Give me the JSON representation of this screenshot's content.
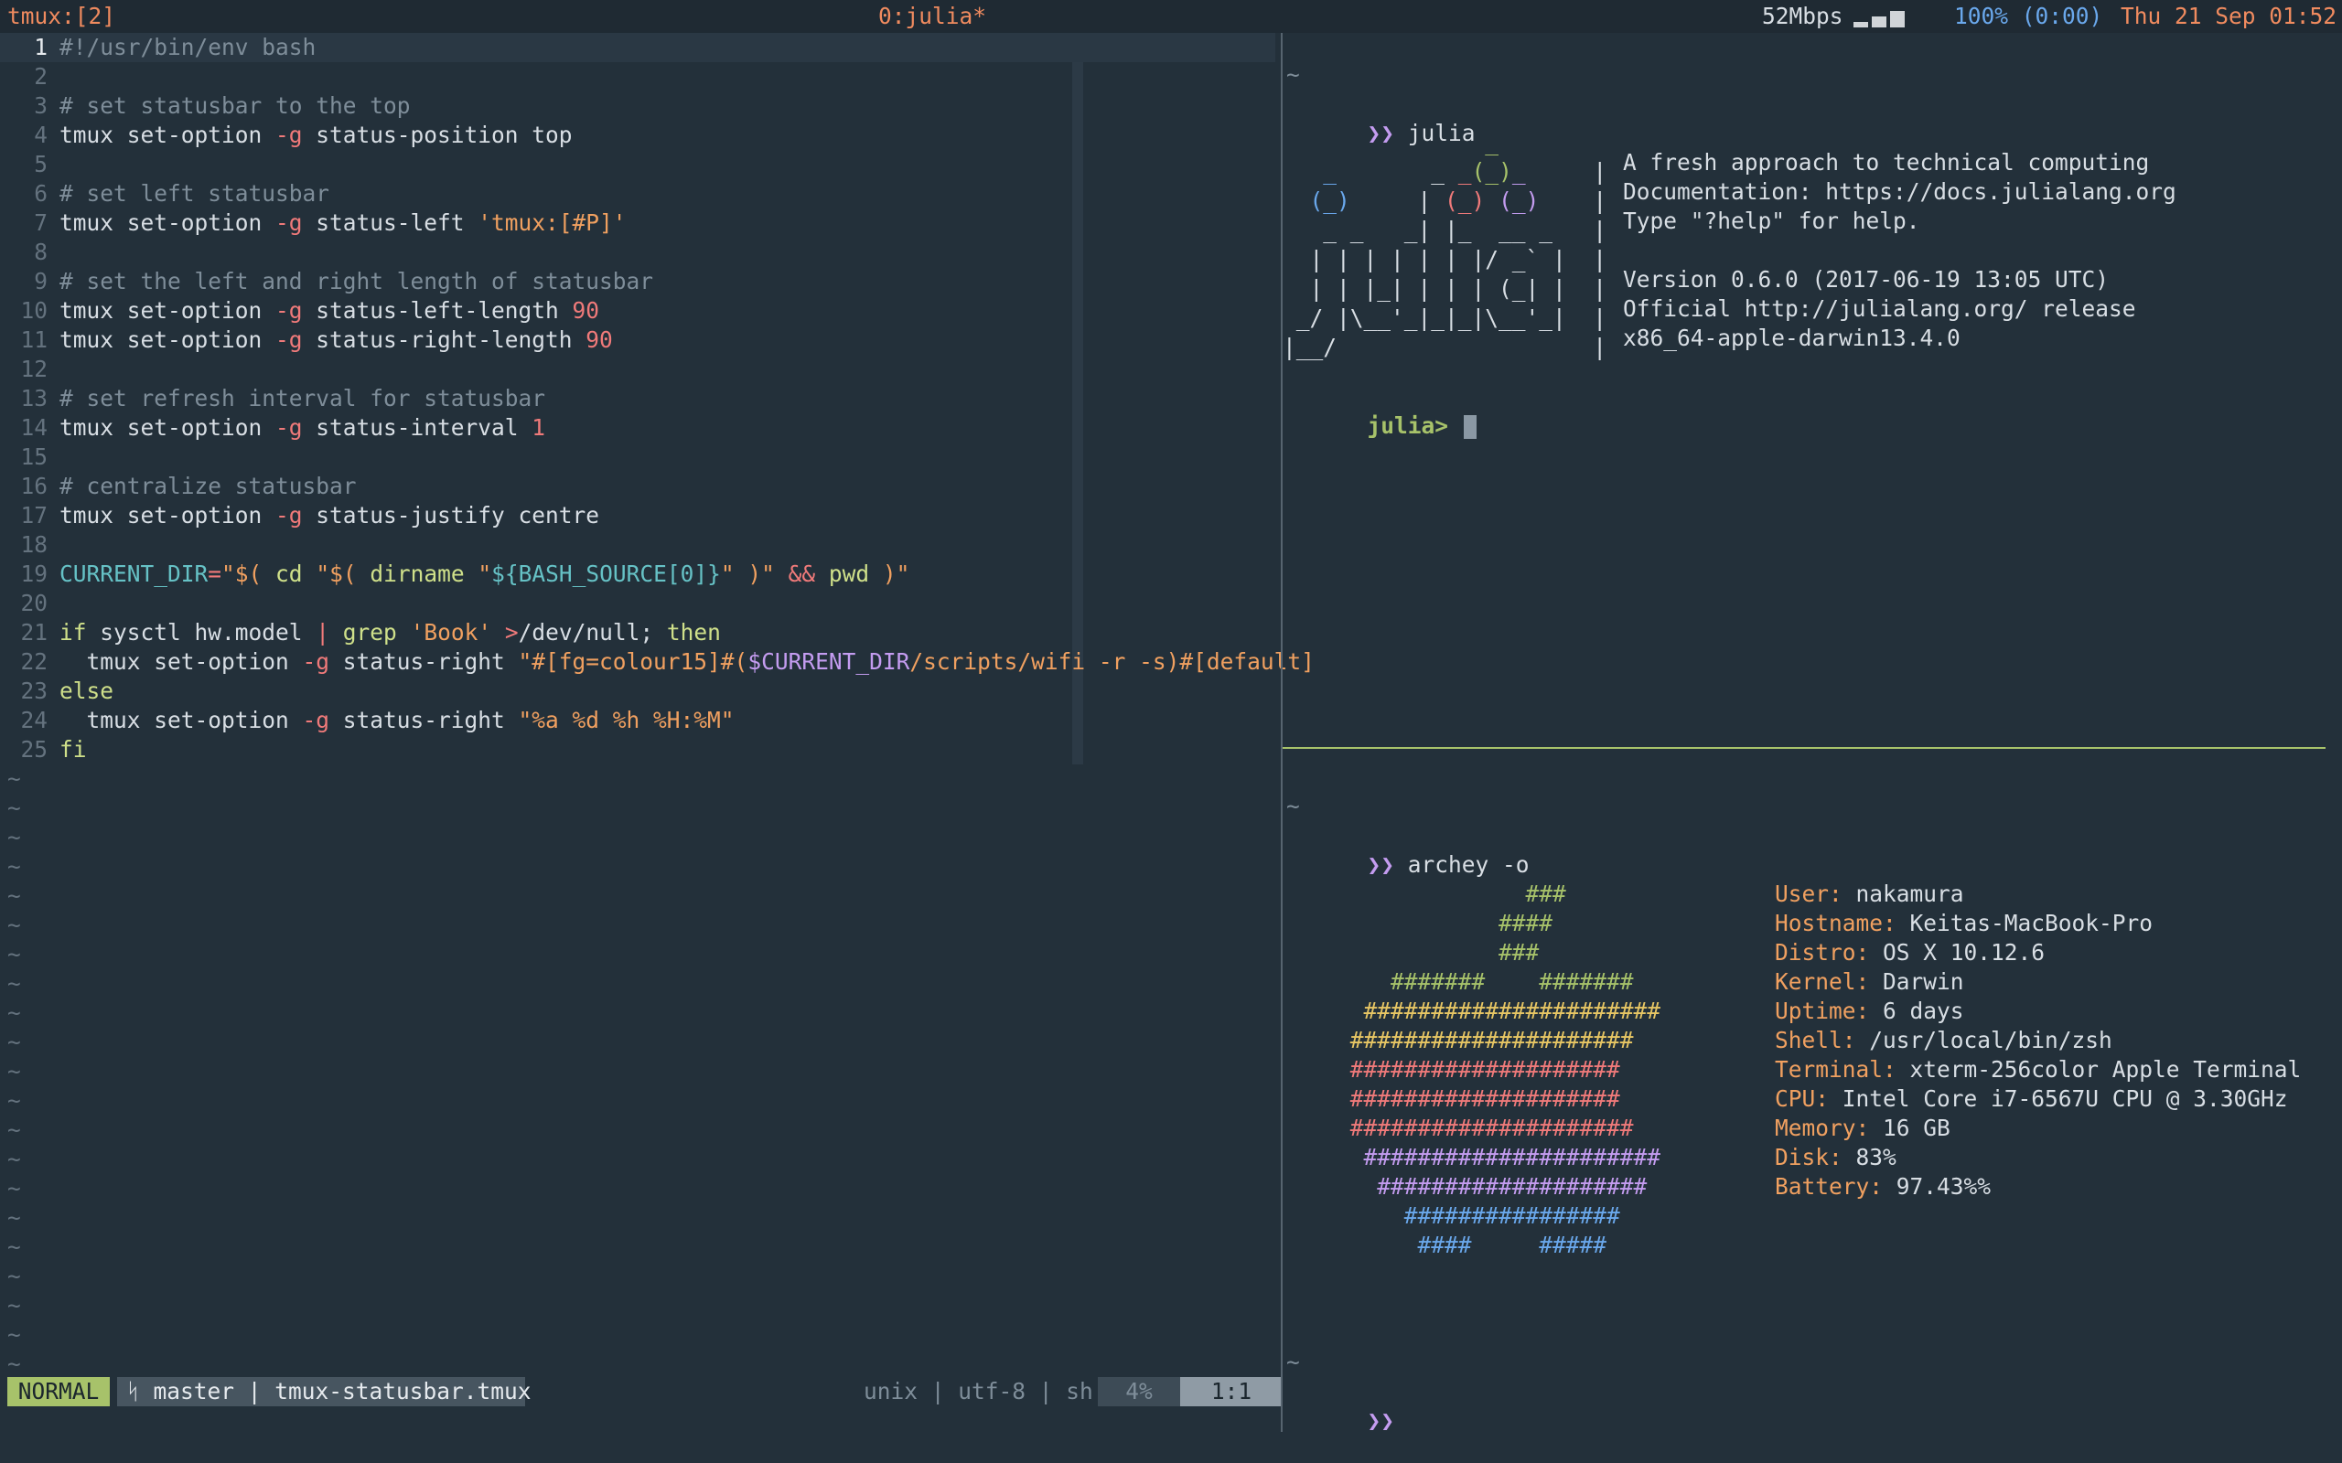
{
  "tmux_status": {
    "session": "tmux:[2]",
    "window": "0:julia*",
    "net_speed": "52Mbps",
    "battery": "100% (0:00)",
    "datetime": "Thu 21 Sep 01:52",
    "wifi_signal_level": 0.75
  },
  "vim": {
    "lines": [
      {
        "n": "1",
        "current": true,
        "parts": [
          {
            "t": "#!/usr/bin/env bash",
            "c": "cm"
          }
        ]
      },
      {
        "n": "2",
        "parts": []
      },
      {
        "n": "3",
        "parts": [
          {
            "t": "# set statusbar to the top",
            "c": "cm"
          }
        ]
      },
      {
        "n": "4",
        "parts": [
          {
            "t": "tmux set-option ",
            "c": "pl"
          },
          {
            "t": "-g",
            "c": "op"
          },
          {
            "t": " status-position top",
            "c": "pl"
          }
        ]
      },
      {
        "n": "5",
        "parts": []
      },
      {
        "n": "6",
        "parts": [
          {
            "t": "# set left statusbar",
            "c": "cm"
          }
        ]
      },
      {
        "n": "7",
        "parts": [
          {
            "t": "tmux set-option ",
            "c": "pl"
          },
          {
            "t": "-g",
            "c": "op"
          },
          {
            "t": " status-left ",
            "c": "pl"
          },
          {
            "t": "'tmux:[#P]'",
            "c": "st"
          }
        ]
      },
      {
        "n": "8",
        "parts": []
      },
      {
        "n": "9",
        "parts": [
          {
            "t": "# set the left and right length of statusbar",
            "c": "cm"
          }
        ]
      },
      {
        "n": "10",
        "parts": [
          {
            "t": "tmux set-option ",
            "c": "pl"
          },
          {
            "t": "-g",
            "c": "op"
          },
          {
            "t": " status-left-length ",
            "c": "pl"
          },
          {
            "t": "90",
            "c": "nu"
          }
        ]
      },
      {
        "n": "11",
        "parts": [
          {
            "t": "tmux set-option ",
            "c": "pl"
          },
          {
            "t": "-g",
            "c": "op"
          },
          {
            "t": " status-right-length ",
            "c": "pl"
          },
          {
            "t": "90",
            "c": "nu"
          }
        ]
      },
      {
        "n": "12",
        "parts": []
      },
      {
        "n": "13",
        "parts": [
          {
            "t": "# set refresh interval for statusbar",
            "c": "cm"
          }
        ]
      },
      {
        "n": "14",
        "parts": [
          {
            "t": "tmux set-option ",
            "c": "pl"
          },
          {
            "t": "-g",
            "c": "op"
          },
          {
            "t": " status-interval ",
            "c": "pl"
          },
          {
            "t": "1",
            "c": "nu"
          }
        ]
      },
      {
        "n": "15",
        "parts": []
      },
      {
        "n": "16",
        "parts": [
          {
            "t": "# centralize statusbar",
            "c": "cm"
          }
        ]
      },
      {
        "n": "17",
        "parts": [
          {
            "t": "tmux set-option ",
            "c": "pl"
          },
          {
            "t": "-g",
            "c": "op"
          },
          {
            "t": " status-justify centre",
            "c": "pl"
          }
        ]
      },
      {
        "n": "18",
        "parts": []
      },
      {
        "n": "19",
        "parts": [
          {
            "t": "CURRENT_DIR",
            "c": "va"
          },
          {
            "t": "=",
            "c": "op"
          },
          {
            "t": "\"$( ",
            "c": "st"
          },
          {
            "t": "cd",
            "c": "kw"
          },
          {
            "t": " \"$( ",
            "c": "st"
          },
          {
            "t": "dirname",
            "c": "kw"
          },
          {
            "t": " \"",
            "c": "st"
          },
          {
            "t": "${BASH_SOURCE[0]}",
            "c": "va"
          },
          {
            "t": "\" )\"",
            "c": "st"
          },
          {
            "t": " && ",
            "c": "op"
          },
          {
            "t": "pwd",
            "c": "kw"
          },
          {
            "t": " )\"",
            "c": "st"
          }
        ]
      },
      {
        "n": "20",
        "parts": []
      },
      {
        "n": "21",
        "parts": [
          {
            "t": "if",
            "c": "kw"
          },
          {
            "t": " sysctl hw.model ",
            "c": "pl"
          },
          {
            "t": "|",
            "c": "op"
          },
          {
            "t": " grep ",
            "c": "kw"
          },
          {
            "t": "'Book'",
            "c": "st"
          },
          {
            "t": " ",
            "c": "pl"
          },
          {
            "t": ">",
            "c": "op"
          },
          {
            "t": "/dev/null; ",
            "c": "pl"
          },
          {
            "t": "then",
            "c": "kw"
          }
        ]
      },
      {
        "n": "22",
        "parts": [
          {
            "t": "  tmux set-option ",
            "c": "pl"
          },
          {
            "t": "-g",
            "c": "op"
          },
          {
            "t": " status-right ",
            "c": "pl"
          },
          {
            "t": "\"#[fg=colour15]#(",
            "c": "st"
          },
          {
            "t": "$CURRENT_DIR",
            "c": "pu"
          },
          {
            "t": "/scripts/wifi -r -s)#[default]",
            "c": "st"
          }
        ]
      },
      {
        "n": "23",
        "parts": [
          {
            "t": "else",
            "c": "kw"
          }
        ]
      },
      {
        "n": "24",
        "parts": [
          {
            "t": "  tmux set-option ",
            "c": "pl"
          },
          {
            "t": "-g",
            "c": "op"
          },
          {
            "t": " status-right ",
            "c": "pl"
          },
          {
            "t": "\"%a %d %h %H:%M\"",
            "c": "st"
          }
        ]
      },
      {
        "n": "25",
        "parts": [
          {
            "t": "fi",
            "c": "kw"
          }
        ]
      }
    ],
    "tilde": "~",
    "statusline": {
      "mode": "NORMAL",
      "branch": "ᛋ master | tmux-statusbar.tmux",
      "fileinfo": "unix | utf-8 | sh",
      "percent": "4%",
      "position": "1:1"
    }
  },
  "julia_pane": {
    "tilde": "~",
    "prompt_arrow": "❯❯",
    "command": "julia",
    "logo_lines": [
      [
        {
          "t": "               ",
          "c": ""
        },
        {
          "t": "_",
          "c": "jg"
        }
      ],
      [
        {
          "t": "   ",
          "c": ""
        },
        {
          "t": "_",
          "c": "jb"
        },
        {
          "t": "       _ ",
          "c": ""
        },
        {
          "t": "_",
          "c": "jr"
        },
        {
          "t": "(_)",
          "c": "jg"
        },
        {
          "t": "_",
          "c": "jp"
        },
        {
          "t": "     |",
          "c": ""
        }
      ],
      [
        {
          "t": "  ",
          "c": ""
        },
        {
          "t": "(_)",
          "c": "jb"
        },
        {
          "t": "     | ",
          "c": ""
        },
        {
          "t": "(_)",
          "c": "jr"
        },
        {
          "t": " ",
          "c": ""
        },
        {
          "t": "(_)",
          "c": "jp"
        },
        {
          "t": "    |",
          "c": ""
        }
      ],
      [
        {
          "t": "   _ _   _| |_  __ _   |",
          "c": ""
        }
      ],
      [
        {
          "t": "  | | | | | | |/ _` |  |",
          "c": ""
        }
      ],
      [
        {
          "t": "  | | |_| | | | (_| |  |",
          "c": ""
        }
      ],
      [
        {
          "t": " _/ |\\__'_|_|_|\\__'_|  |",
          "c": ""
        }
      ],
      [
        {
          "t": "|__/                   |",
          "c": ""
        }
      ]
    ],
    "info_lines": [
      "A fresh approach to technical computing",
      "Documentation: https://docs.julialang.org",
      "Type \"?help\" for help.",
      "",
      "Version 0.6.0 (2017-06-19 13:05 UTC)",
      "Official http://julialang.org/ release",
      "x86_64-apple-darwin13.4.0"
    ],
    "repl_prompt": "julia>"
  },
  "archey_pane": {
    "tilde": "~",
    "prompt_arrow": "❯❯",
    "command": "archey -o",
    "logo_lines": [
      {
        "t": "                  ###",
        "c": "a-g"
      },
      {
        "t": "                ####",
        "c": "a-g"
      },
      {
        "t": "                ###",
        "c": "a-g"
      },
      {
        "t": "        #######    #######",
        "c": "a-g"
      },
      {
        "t": "      ######################",
        "c": "a-y"
      },
      {
        "t": "     #####################",
        "c": "a-y"
      },
      {
        "t": "     ####################",
        "c": "a-r"
      },
      {
        "t": "     ####################",
        "c": "a-r"
      },
      {
        "t": "     #####################",
        "c": "a-r"
      },
      {
        "t": "      ######################",
        "c": "a-p"
      },
      {
        "t": "       ####################",
        "c": "a-p"
      },
      {
        "t": "         ################",
        "c": "a-b"
      },
      {
        "t": "          ####     #####",
        "c": "a-b"
      }
    ],
    "sysinfo": [
      {
        "key": "User:",
        "value": "nakamura"
      },
      {
        "key": "Hostname:",
        "value": "Keitas-MacBook-Pro"
      },
      {
        "key": "Distro:",
        "value": "OS X 10.12.6"
      },
      {
        "key": "Kernel:",
        "value": "Darwin"
      },
      {
        "key": "Uptime:",
        "value": "6 days"
      },
      {
        "key": "Shell:",
        "value": "/usr/local/bin/zsh"
      },
      {
        "key": "Terminal:",
        "value": "xterm-256color Apple Terminal"
      },
      {
        "key": "CPU:",
        "value": "Intel Core i7-6567U CPU @ 3.30GHz"
      },
      {
        "key": "Memory:",
        "value": "16 GB"
      },
      {
        "key": "Disk:",
        "value": "83%"
      },
      {
        "key": "Battery:",
        "value": "97.43%%"
      }
    ]
  },
  "bottom_pane": {
    "tilde": "~",
    "prompt_arrow": "❯❯"
  },
  "colors": {
    "background": "#23303a",
    "accent_green": "#a7c26a",
    "accent_orange": "#f0a060",
    "accent_purple": "#c49cf0"
  }
}
